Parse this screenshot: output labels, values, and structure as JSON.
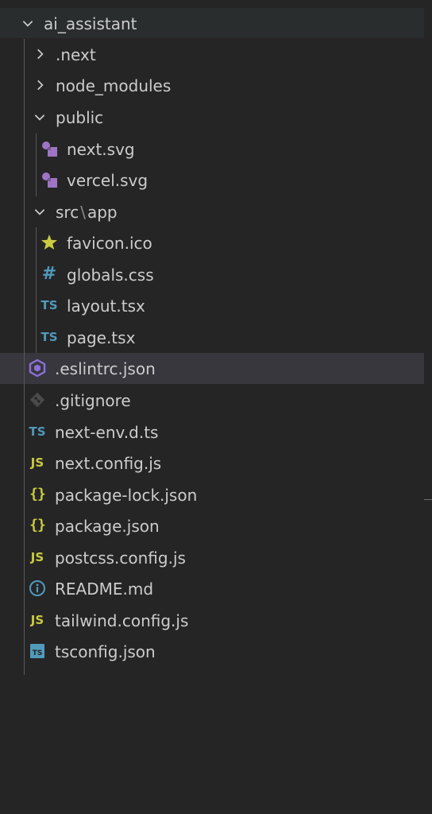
{
  "explorer": {
    "root": {
      "label": "ai_assistant",
      "expanded": true
    },
    "items": [
      {
        "label": ".next",
        "type": "folder",
        "expanded": false
      },
      {
        "label": "node_modules",
        "type": "folder",
        "expanded": false
      },
      {
        "label": "public",
        "type": "folder",
        "expanded": true
      },
      {
        "label": "next.svg",
        "type": "file",
        "icon": "svg-icon"
      },
      {
        "label": "vercel.svg",
        "type": "file",
        "icon": "svg-icon"
      },
      {
        "label_a": "src",
        "separator": "\\",
        "label_b": "app",
        "type": "folder",
        "expanded": true
      },
      {
        "label": "favicon.ico",
        "type": "file",
        "icon": "star-icon"
      },
      {
        "label": "globals.css",
        "type": "file",
        "icon": "hash-icon",
        "glyph": "#"
      },
      {
        "label": "layout.tsx",
        "type": "file",
        "icon": "typescript-icon",
        "glyph": "TS"
      },
      {
        "label": "page.tsx",
        "type": "file",
        "icon": "typescript-icon",
        "glyph": "TS"
      },
      {
        "label": ".eslintrc.json",
        "type": "file",
        "icon": "eslint-icon",
        "selected": true
      },
      {
        "label": ".gitignore",
        "type": "file",
        "icon": "git-icon"
      },
      {
        "label": "next-env.d.ts",
        "type": "file",
        "icon": "typescript-icon",
        "glyph": "TS"
      },
      {
        "label": "next.config.js",
        "type": "file",
        "icon": "javascript-icon",
        "glyph": "JS"
      },
      {
        "label": "package-lock.json",
        "type": "file",
        "icon": "json-icon",
        "glyph": "{}"
      },
      {
        "label": "package.json",
        "type": "file",
        "icon": "json-icon",
        "glyph": "{}"
      },
      {
        "label": "postcss.config.js",
        "type": "file",
        "icon": "javascript-icon",
        "glyph": "JS"
      },
      {
        "label": "README.md",
        "type": "file",
        "icon": "info-icon"
      },
      {
        "label": "tailwind.config.js",
        "type": "file",
        "icon": "javascript-icon",
        "glyph": "JS"
      },
      {
        "label": "tsconfig.json",
        "type": "file",
        "icon": "tsconfig-icon",
        "glyph": "TS"
      }
    ]
  },
  "colors": {
    "background": "#252526",
    "selected_row": "#37373d",
    "text": "#cccccc",
    "typescript": "#519aba",
    "javascript": "#cbcb41",
    "svg_purple": "#a074c4",
    "eslint_purple": "#8c6fd8",
    "git_gray": "#4a4a4a"
  }
}
